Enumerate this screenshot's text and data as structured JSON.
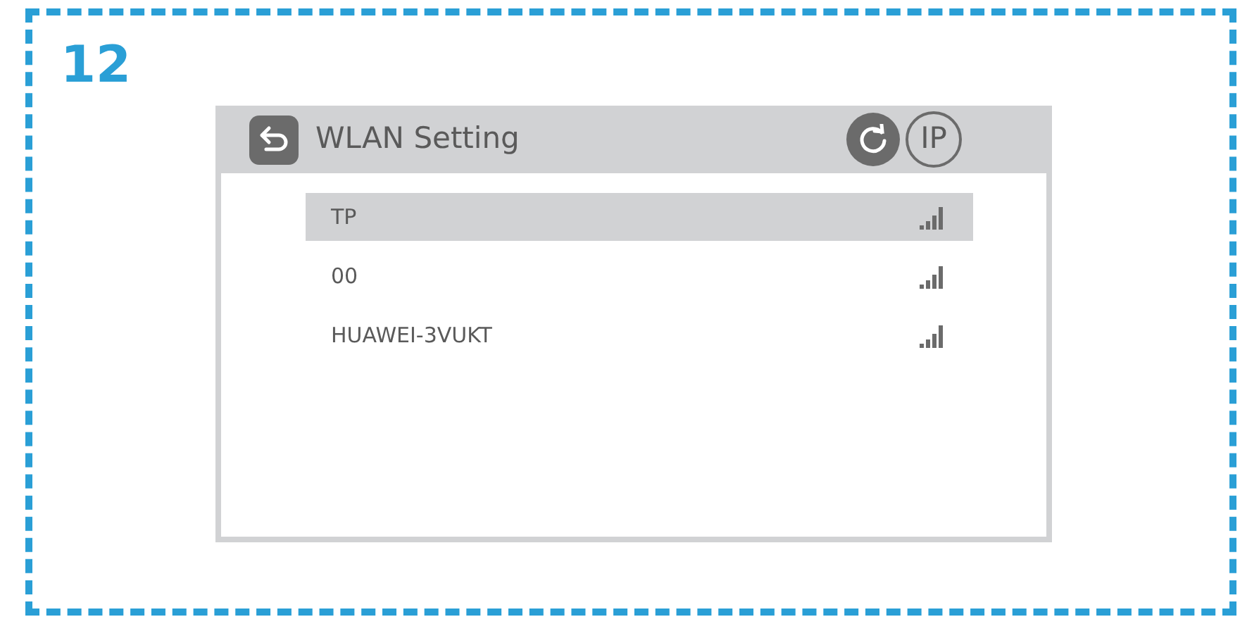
{
  "step": "12",
  "header": {
    "title": "WLAN Setting",
    "ip_button": "IP"
  },
  "networks": [
    {
      "name": "TP",
      "selected": true
    },
    {
      "name": "00",
      "selected": false
    },
    {
      "name": "HUAWEI-3VUKT",
      "selected": false
    }
  ]
}
